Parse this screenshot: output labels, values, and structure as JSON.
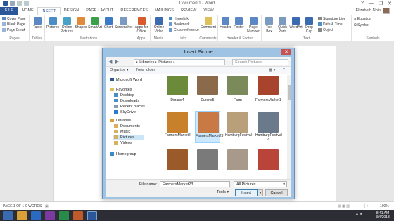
{
  "window": {
    "title": "Document1 - Word",
    "controls": [
      "?",
      "—",
      "❐",
      "✕"
    ]
  },
  "user": {
    "name": "Elizabeth Noils"
  },
  "tabs": [
    "FILE",
    "HOME",
    "INSERT",
    "DESIGN",
    "PAGE LAYOUT",
    "REFERENCES",
    "MAILINGS",
    "REVIEW",
    "VIEW"
  ],
  "ribbon": {
    "pages": {
      "label": "Pages",
      "items": [
        "Cover Page",
        "Blank Page",
        "Page Break"
      ]
    },
    "tables": {
      "label": "Tables",
      "button": "Table"
    },
    "illustrations": {
      "label": "Illustrations",
      "buttons": [
        "Pictures",
        "Online Pictures",
        "Shapes",
        "SmartArt",
        "Chart",
        "Screenshot"
      ]
    },
    "apps": {
      "label": "Apps",
      "buttons": [
        "Apps for Office"
      ]
    },
    "media": {
      "label": "Media",
      "buttons": [
        "Online Video"
      ]
    },
    "links": {
      "label": "Links",
      "items": [
        "Hyperlink",
        "Bookmark",
        "Cross-reference"
      ]
    },
    "comments": {
      "label": "Comments",
      "button": "Comment"
    },
    "header_footer": {
      "label": "Header & Footer",
      "buttons": [
        "Header",
        "Footer",
        "Page Number"
      ]
    },
    "text": {
      "label": "Text",
      "buttons": [
        "Text Box",
        "Quick Parts",
        "WordArt",
        "Drop Cap"
      ],
      "items": [
        "Signature Line",
        "Date & Time",
        "Object"
      ]
    },
    "symbols": {
      "label": "Symbols",
      "items": [
        "Equation",
        "Symbol"
      ]
    }
  },
  "status": {
    "page": "PAGE 1 OF 1",
    "words": "0 WORDS",
    "zoom": "100%"
  },
  "taskbar": {
    "time": "8:41 AM",
    "date": "3/4/2013"
  },
  "dialog": {
    "title": "Insert Picture",
    "path": [
      "Libraries",
      "Pictures"
    ],
    "search_placeholder": "Search Pictures",
    "organize": "Organize ▾",
    "new_folder": "New folder",
    "nav": {
      "microsoft_word": "Microsoft Word",
      "favorites": "Favorites",
      "fav_items": [
        "Desktop",
        "Downloads",
        "Recent places",
        "SkyDrive"
      ],
      "libraries": "Libraries",
      "lib_items": [
        "Documents",
        "Music",
        "Pictures",
        "Videos"
      ],
      "homegroup": "Homegroup"
    },
    "files": [
      {
        "name": "Durand4",
        "color": "#6b8a3a"
      },
      {
        "name": "Durand5",
        "color": "#8a6a4a"
      },
      {
        "name": "Farm",
        "color": "#7a8a5a"
      },
      {
        "name": "FarmersMarket1",
        "color": "#a8442e"
      },
      {
        "name": "FarmersMarket2",
        "color": "#c9802a"
      },
      {
        "name": "FarmersMarket23",
        "color": "#c97a44"
      },
      {
        "name": "HamburgFestival",
        "color": "#b9a07a"
      },
      {
        "name": "HamburgFestival 2",
        "color": "#6a7a8a"
      },
      {
        "name": "",
        "color": "#9a5a2a"
      },
      {
        "name": "",
        "color": "#7a7a7a"
      },
      {
        "name": "",
        "color": "#a89a8a"
      },
      {
        "name": "",
        "color": "#b9443a"
      }
    ],
    "file_name_label": "File name:",
    "file_name": "FarmersMarket23",
    "filter": "All Pictures",
    "tools": "Tools ▾",
    "insert": "Insert",
    "cancel": "Cancel"
  }
}
